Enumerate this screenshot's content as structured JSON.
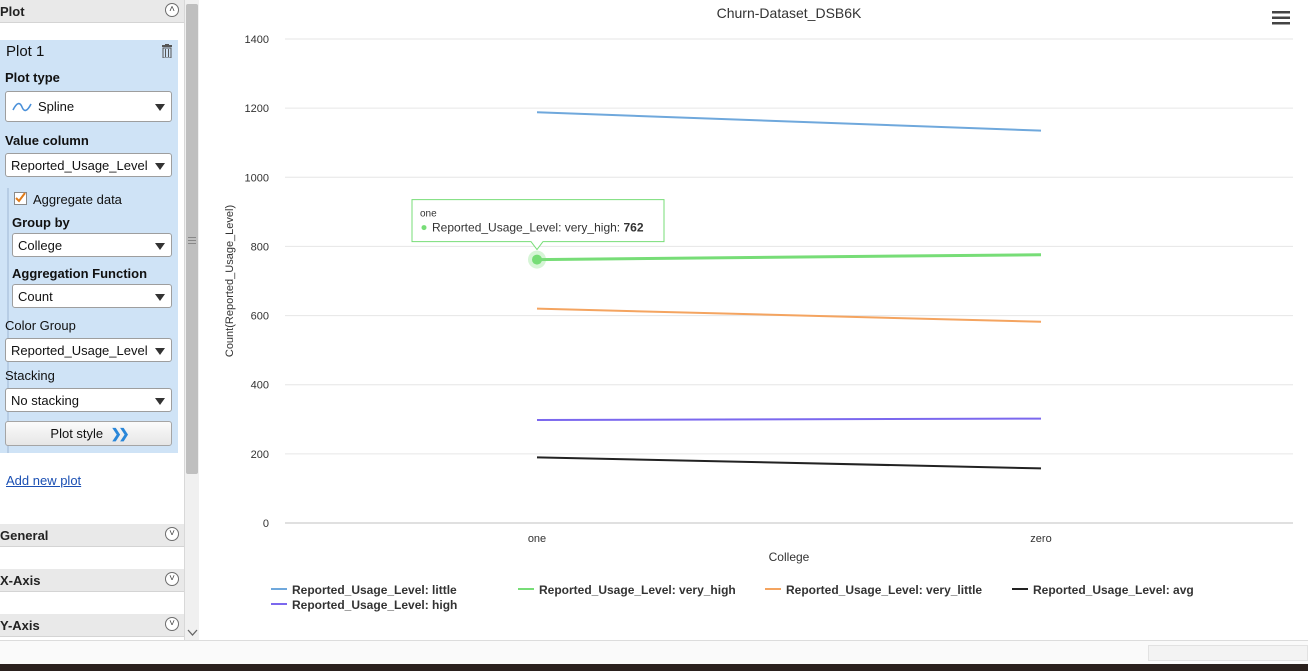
{
  "panel": {
    "plot_section": "Plot",
    "plot_title": "Plot 1",
    "plot_type_label": "Plot type",
    "plot_type_value": "Spline",
    "value_column_label": "Value column",
    "value_column_value": "Reported_Usage_Level",
    "aggregate_label": "Aggregate data",
    "aggregate_checked": true,
    "group_by_label": "Group by",
    "group_by_value": "College",
    "agg_function_label": "Aggregation Function",
    "agg_function_value": "Count",
    "color_group_label": "Color Group",
    "color_group_value": "Reported_Usage_Level",
    "stacking_label": "Stacking",
    "stacking_value": "No stacking",
    "plot_style_button": "Plot style",
    "add_new_plot": "Add new plot",
    "sections": [
      "General",
      "X-Axis",
      "Y-Axis"
    ]
  },
  "chart_data": {
    "type": "line",
    "title": "Churn-Dataset_DSB6K",
    "xlabel": "College",
    "ylabel": "Count(Reported_Usage_Level)",
    "categories": [
      "one",
      "zero"
    ],
    "ylim": [
      0,
      1400
    ],
    "yticks": [
      "0",
      "200",
      "400",
      "600",
      "800",
      "1000",
      "1200",
      "1400"
    ],
    "grid": true,
    "legend_position": "bottom",
    "series": [
      {
        "name": "Reported_Usage_Level: little",
        "color": "#6fa8dc",
        "values": [
          1188,
          1135
        ]
      },
      {
        "name": "Reported_Usage_Level: very_high",
        "color": "#77dd77",
        "values": [
          762,
          776
        ]
      },
      {
        "name": "Reported_Usage_Level: very_little",
        "color": "#f4a460",
        "values": [
          620,
          582
        ]
      },
      {
        "name": "Reported_Usage_Level: avg",
        "color": "#222222",
        "values": [
          190,
          158
        ]
      },
      {
        "name": "Reported_Usage_Level: high",
        "color": "#7b68ee",
        "values": [
          298,
          302
        ]
      }
    ],
    "tooltip": {
      "category": "one",
      "series": "Reported_Usage_Level: very_high",
      "value_text": "762"
    }
  }
}
